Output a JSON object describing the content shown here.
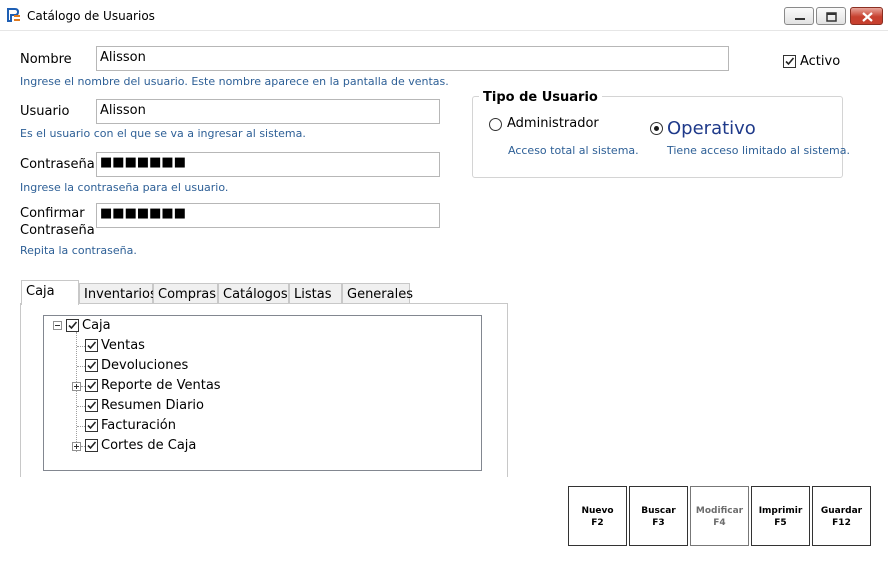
{
  "window": {
    "title": "Catálogo de Usuarios",
    "icon": "app-logo-icon"
  },
  "form": {
    "nombre": {
      "label": "Nombre",
      "value": "Alisson",
      "hint": "Ingrese el nombre del usuario. Este nombre aparece en la pantalla de ventas."
    },
    "usuario": {
      "label": "Usuario",
      "value": "Alisson",
      "hint": "Es el usuario con el que se va a ingresar al sistema."
    },
    "contrasena": {
      "label": "Contraseña",
      "value": "■■■■■■■",
      "hint": "Ingrese la contraseña para el usuario."
    },
    "confirmar": {
      "label_line1": "Confirmar",
      "label_line2": "Contraseña",
      "value": "■■■■■■■",
      "hint": "Repita la contraseña."
    },
    "activo": {
      "label": "Activo",
      "checked": true
    }
  },
  "tipo_usuario": {
    "title": "Tipo de Usuario",
    "options": [
      {
        "label": "Administrador",
        "description": "Acceso total al sistema.",
        "selected": false
      },
      {
        "label": "Operativo",
        "description": "Tiene acceso limitado al sistema.",
        "selected": true
      }
    ]
  },
  "tabs": [
    {
      "label": "Caja",
      "active": true
    },
    {
      "label": "Inventarios",
      "active": false
    },
    {
      "label": "Compras",
      "active": false
    },
    {
      "label": "Catálogos",
      "active": false
    },
    {
      "label": "Listas",
      "active": false
    },
    {
      "label": "Generales",
      "active": false
    }
  ],
  "tree": {
    "root": {
      "label": "Caja",
      "checked": true,
      "expanded": true
    },
    "children": [
      {
        "label": "Ventas",
        "checked": true,
        "expandable": false
      },
      {
        "label": "Devoluciones",
        "checked": true,
        "expandable": false
      },
      {
        "label": "Reporte de Ventas",
        "checked": true,
        "expandable": true
      },
      {
        "label": "Resumen Diario",
        "checked": true,
        "expandable": false
      },
      {
        "label": "Facturación",
        "checked": true,
        "expandable": false
      },
      {
        "label": "Cortes de Caja",
        "checked": true,
        "expandable": true
      }
    ]
  },
  "actions": [
    {
      "label": "Nuevo",
      "key": "F2",
      "enabled": true
    },
    {
      "label": "Buscar",
      "key": "F3",
      "enabled": true
    },
    {
      "label": "Modificar",
      "key": "F4",
      "enabled": false
    },
    {
      "label": "Imprimir",
      "key": "F5",
      "enabled": true
    },
    {
      "label": "Guardar",
      "key": "F12",
      "enabled": true
    }
  ],
  "colors": {
    "hint_text": "#2d5f96",
    "selected_radio_text": "#1f3a8a",
    "close_button": "#c7402f"
  }
}
